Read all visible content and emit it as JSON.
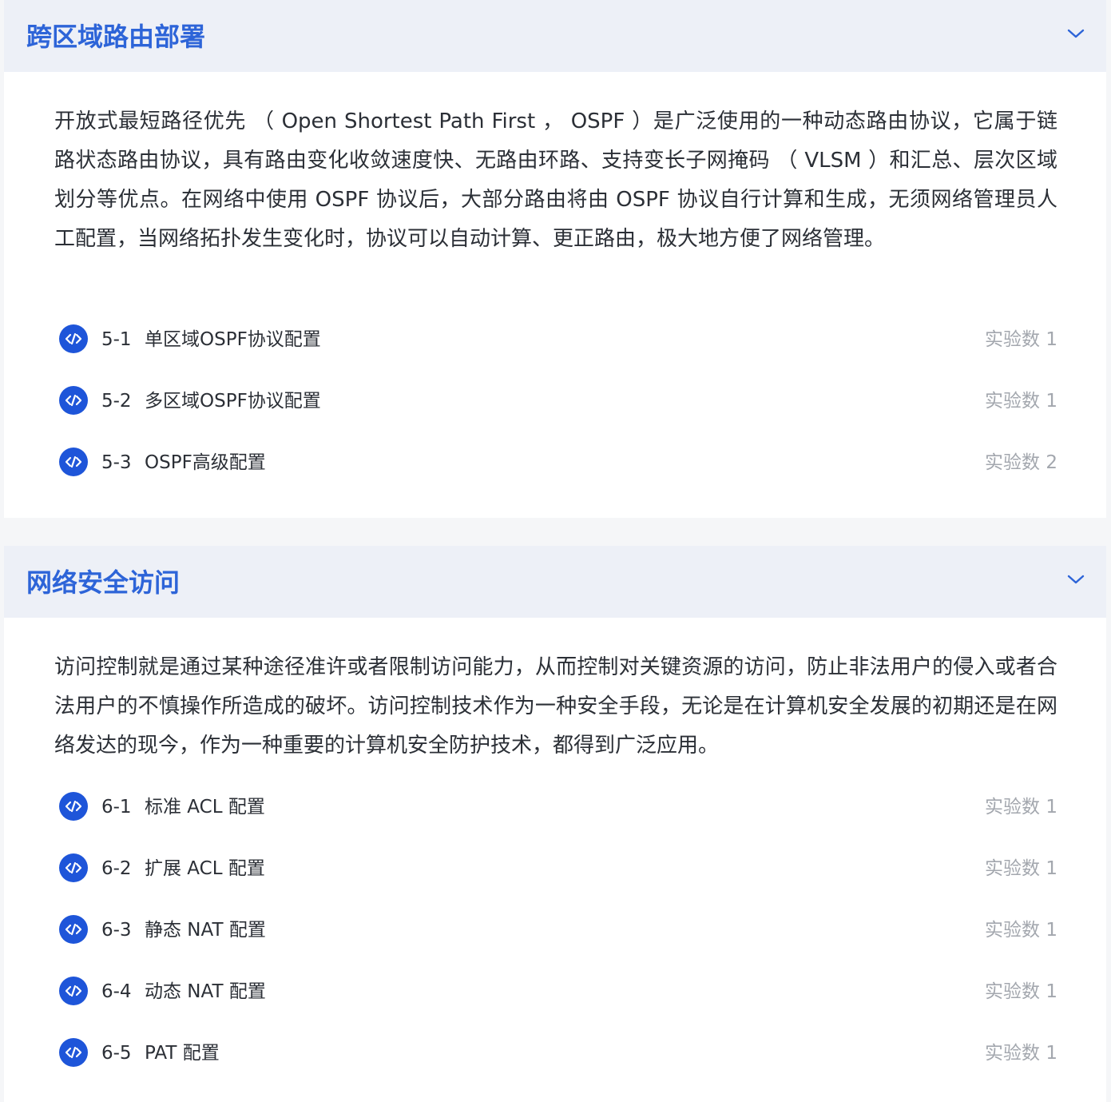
{
  "sections": [
    {
      "title": "跨区域路由部署",
      "description": "开放式最短路径优先 （ Open Shortest Path First ， OSPF ）是广泛使用的一种动态路由协议，它属于链路状态路由协议，具有路由变化收敛速度快、无路由环路、支持变长子网掩码 （ VLSM ）和汇总、层次区域划分等优点。在网络中使用 OSPF 协议后，大部分路由将由 OSPF 协议自行计算和生成，无须网络管理员人工配置，当网络拓扑发生变化时，协议可以自动计算、更正路由，极大地方便了网络管理。",
      "items": [
        {
          "num": "5-1",
          "name": "单区域OSPF协议配置",
          "count": "实验数 1"
        },
        {
          "num": "5-2",
          "name": "多区域OSPF协议配置",
          "count": "实验数 1"
        },
        {
          "num": "5-3",
          "name": "OSPF高级配置",
          "count": "实验数 2"
        }
      ]
    },
    {
      "title": "网络安全访问",
      "description": "访问控制就是通过某种途径准许或者限制访问能力，从而控制对关键资源的访问，防止非法用户的侵入或者合法用户的不慎操作所造成的破坏。访问控制技术作为一种安全手段，无论是在计算机安全发展的初期还是在网络发达的现今，作为一种重要的计算机安全防护技术，都得到广泛应用。",
      "items": [
        {
          "num": "6-1",
          "name": "标准 ACL 配置",
          "count": "实验数 1"
        },
        {
          "num": "6-2",
          "name": "扩展 ACL 配置",
          "count": "实验数 1"
        },
        {
          "num": "6-3",
          "name": "静态 NAT 配置",
          "count": "实验数 1"
        },
        {
          "num": "6-4",
          "name": "动态 NAT 配置",
          "count": "实验数 1"
        },
        {
          "num": "6-5",
          "name": "PAT 配置",
          "count": "实验数 1"
        }
      ]
    }
  ],
  "colors": {
    "accent": "#2d64d8",
    "icon_bg": "#1e55d9",
    "header_bg": "#edf0f7",
    "muted": "#a3a7ae"
  },
  "icons": {
    "chevron": "chevron-down-icon",
    "item": "code-icon"
  }
}
